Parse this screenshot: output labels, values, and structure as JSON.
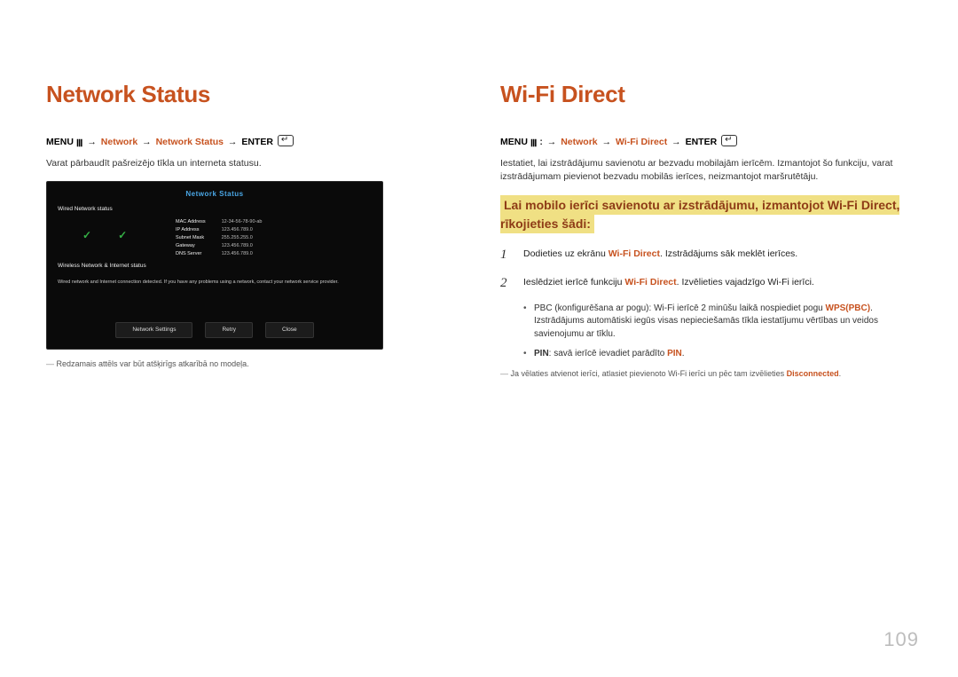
{
  "left": {
    "title": "Network Status",
    "menu": {
      "menu": "MENU",
      "seg1": "Network",
      "seg2": "Network Status",
      "seg3": "ENTER"
    },
    "desc": "Varat pārbaudīt pašreizējo tīkla un interneta statusu.",
    "shot": {
      "title": "Network Status",
      "sub": "Wired Network status",
      "info": {
        "labels": [
          "MAC Address",
          "IP Address",
          "Subnet Mask",
          "Gateway",
          "DNS Server"
        ],
        "values": [
          "12-34-56-78-90-ab",
          "123.456.789.0",
          "255.255.255.0",
          "123.456.789.0",
          "123.456.789.0"
        ]
      },
      "block2": "Wireless Network & Internet status",
      "msg": "Wired network and Internet connection detected. If you have any problems using a network, contact your network service provider.",
      "buttons": [
        "Network Settings",
        "Retry",
        "Close"
      ]
    },
    "caption": "Redzamais attēls var būt atšķirīgs atkarībā no modeļa."
  },
  "right": {
    "title": "Wi-Fi Direct",
    "menu": {
      "menu": "MENU",
      "seg1": "Network",
      "seg2": "Wi-Fi Direct",
      "seg3": "ENTER"
    },
    "desc": "Iestatiet, lai izstrādājumu savienotu ar bezvadu mobilajām ierīcēm. Izmantojot šo funkciju, varat izstrādājumam pievienot bezvadu mobilās ierīces, neizmantojot maršrutētāju.",
    "highlight": "Lai mobilo ierīci savienotu ar izstrādājumu, izmantojot Wi-Fi Direct, rīkojieties šādi:",
    "steps": [
      {
        "n": "1",
        "pre": "Dodieties uz ekrānu ",
        "term": "Wi-Fi Direct",
        "post": ". Izstrādājums sāk meklēt ierīces."
      },
      {
        "n": "2",
        "pre": "Ieslēdziet ierīcē funkciju ",
        "term": "Wi-Fi Direct",
        "post": ". Izvēlieties vajadzīgo Wi-Fi ierīci."
      }
    ],
    "sub": [
      {
        "pre": "PBC (konfigurēšana ar pogu): Wi-Fi ierīcē 2 minūšu laikā nospiediet pogu ",
        "term": "WPS(PBC)",
        "post": ". Izstrādājums automātiski iegūs visas nepieciešamās tīkla iestatījumu vērtības un veidos savienojumu ar tīklu."
      },
      {
        "preb": "PIN",
        "pre": ": savā ierīcē ievadiet parādīto ",
        "term": "PIN",
        "post": "."
      }
    ],
    "footnote": {
      "pre": "Ja vēlaties atvienot ierīci, atlasiet pievienoto Wi-Fi ierīci un pēc tam izvēlieties ",
      "term": "Disconnected",
      "post": "."
    }
  },
  "pageNumber": "109"
}
